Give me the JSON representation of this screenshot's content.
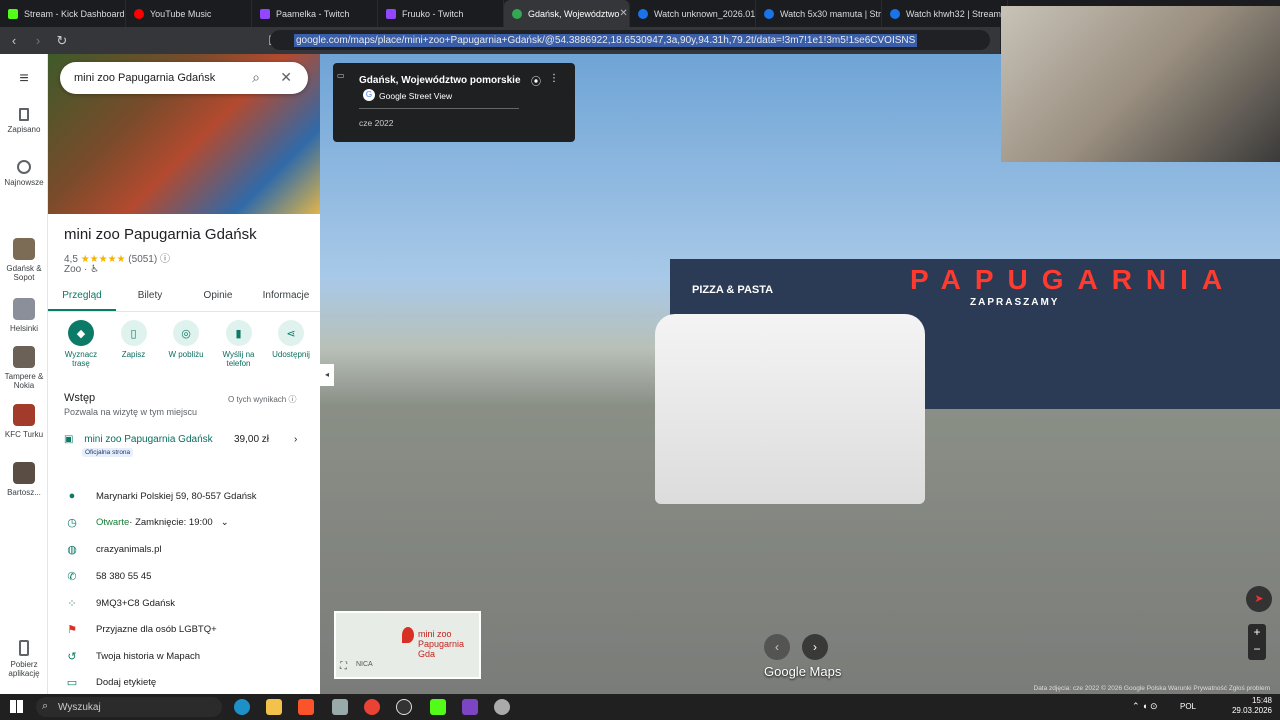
{
  "browser": {
    "tabs": [
      {
        "label": "Stream - Kick Dashboard",
        "color": "#53fc18"
      },
      {
        "label": "YouTube Music",
        "color": "#ff0000"
      },
      {
        "label": "Paamelka - Twitch",
        "color": "#9146ff"
      },
      {
        "label": "Fruuko - Twitch",
        "color": "#9146ff"
      },
      {
        "label": "Gdańsk, Województwo",
        "color": "#34a853",
        "active": true
      },
      {
        "label": "Watch unknown_2026.01",
        "color": "#1a73e8"
      },
      {
        "label": "Watch 5x30 mamuta | Str",
        "color": "#1a73e8"
      },
      {
        "label": "Watch khwh32 | Streama",
        "color": "#1a73e8"
      }
    ],
    "url": "google.com/maps/place/mini+zoo+Papugarnia+Gdańsk/@54.3886922,18.6530947,3a,90y,94.31h,79.2t/data=!3m7!1e1!3m5!1se6CVOISNS"
  },
  "rail": {
    "items": [
      {
        "label": "Zapisano",
        "icon": "bookmark-icon"
      },
      {
        "label": "Najnowsze",
        "icon": "history-icon"
      },
      {
        "label": "Gdańsk & Sopot",
        "icon": "place-thumb"
      },
      {
        "label": "Helsinki",
        "icon": "place-thumb"
      },
      {
        "label": "Tampere & Nokia",
        "icon": "place-thumb"
      },
      {
        "label": "KFC Turku",
        "icon": "place-thumb"
      },
      {
        "label": "Bartosz...",
        "icon": "place-thumb"
      },
      {
        "label": "Pobierz aplikację",
        "icon": "phone-icon"
      }
    ]
  },
  "panel": {
    "search_value": "mini zoo Papugarnia Gdańsk",
    "title": "mini zoo Papugarnia Gdańsk",
    "rating_value": "4,5",
    "rating_stars": "★★★★★",
    "rating_count": "(5051)",
    "category": "Zoo · ♿",
    "tabs": [
      "Przegląd",
      "Bilety",
      "Opinie",
      "Informacje"
    ],
    "actions": [
      {
        "label": "Wyznacz trasę",
        "icon": "directions-icon"
      },
      {
        "label": "Zapisz",
        "icon": "bookmark-icon"
      },
      {
        "label": "W pobliżu",
        "icon": "nearby-icon"
      },
      {
        "label": "Wyślij na telefon",
        "icon": "send-to-phone-icon"
      },
      {
        "label": "Udostępnij",
        "icon": "share-icon"
      }
    ],
    "intro_title": "Wstęp",
    "intro_sub": "Pozwala na wizytę w tym miejscu",
    "results_about": "O tych wynikach",
    "ticket_name": "mini zoo Papugarnia Gdańsk",
    "ticket_badge": "Oficjalna strona",
    "ticket_price": "39,00 zł",
    "info": [
      {
        "icon": "location-pin-icon",
        "text": "Marynarki Polskiej 59, 80-557 Gdańsk"
      },
      {
        "icon": "clock-icon",
        "text_open": "Otwarte",
        "text_rest": " · Zamknięcie: 19:00"
      },
      {
        "icon": "globe-icon",
        "text": "crazyanimals.pl"
      },
      {
        "icon": "phone-icon",
        "text": "58 380 55 45"
      },
      {
        "icon": "plus-code-icon",
        "text": "9MQ3+C8 Gdańsk"
      },
      {
        "icon": "rainbow-flag-icon",
        "text": "Przyjazne dla osób LGBTQ+"
      },
      {
        "icon": "history-icon",
        "text": "Twoja historia w Mapach"
      },
      {
        "icon": "label-icon",
        "text": "Dodaj etykietę"
      }
    ]
  },
  "streetview": {
    "place": "Gdańsk, Województwo pomorskie",
    "provider": "Google Street View",
    "date": "cze 2022",
    "minimap_label": "mini zoo Papugarnia Gda",
    "minimap_street": "NICA",
    "brand": "Google Maps",
    "sign_main": "PAPUGARNIA",
    "sign_sub": "ZAPRASZAMY",
    "sign_pizza": "PIZZA & PASTA",
    "attribution": "Data zdjęcia: cze 2022   © 2026 Google   Polska   Warunki   Prywatność   Zgłoś problem"
  },
  "taskbar": {
    "search_placeholder": "Wyszukaj",
    "lang": "POL",
    "time": "15:48",
    "date": "29.03.2026"
  }
}
